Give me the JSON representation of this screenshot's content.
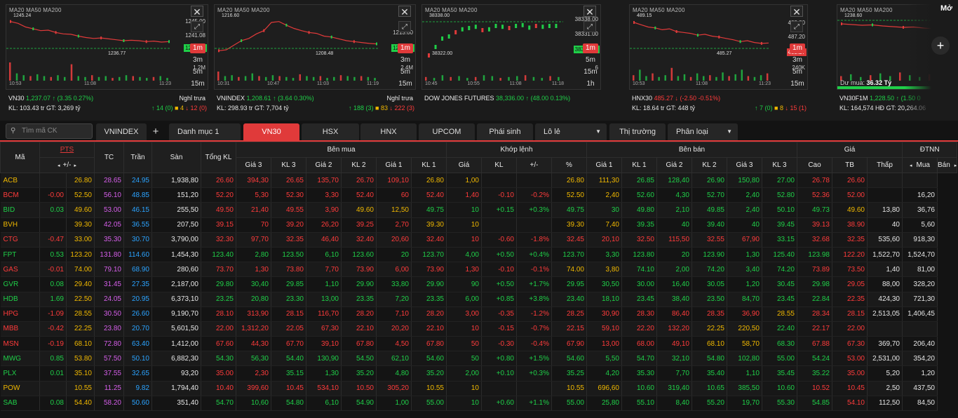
{
  "charts": [
    {
      "ma": "MA20 MA50 MA200",
      "hi": "1245.24",
      "lo": "1236.77",
      "axis": [
        "1245.00",
        "1241.08",
        "1237.37",
        "1.2M"
      ],
      "times": [
        "10:53",
        "11:08",
        "11:23"
      ],
      "name": "VN30",
      "price": "1,237.07",
      "change": "↑ (3.35 0.27%)",
      "status": "Nghỉ trưa",
      "kl": "KL: 103.43 tr",
      "gt": "GT: 3,269 tỷ",
      "up": "↑ 14 (0)",
      "ref": "■ 4",
      "down": "↓ 12 (0)",
      "tf": [
        "1m",
        "3m",
        "5m",
        "15m"
      ]
    },
    {
      "ma": "MA20 MA50 MA200",
      "hi": "1216.60",
      "lo": "1208.48",
      "axis": [
        "1213.00",
        "1208.60",
        "2.4M"
      ],
      "times": [
        "10:31",
        "10:47",
        "11:03",
        "11:19"
      ],
      "name": "VNINDEX",
      "price": "1,208.61",
      "change": "↑ (3.64 0.30%)",
      "status": "Nghỉ trưa",
      "kl": "KL: 298.93 tr",
      "gt": "GT: 7,704 tỷ",
      "up": "↑ 188 (3)",
      "ref": "■ 83",
      "down": "↓ 222 (3)",
      "tf": [
        "1m",
        "3m",
        "5m",
        "15m"
      ]
    },
    {
      "ma": "MA20 MA50 MA200",
      "hi": "38338.00",
      "lo": "38322.00",
      "axis": [
        "38338.00",
        "38331.00",
        "38322.00",
        "6"
      ],
      "times": [
        "10:45",
        "10:55",
        "11:08",
        "11:18"
      ],
      "name": "DOW JONES FUTURES",
      "price": "38,336.00",
      "change": "↑ (48.00 0.13%)",
      "status": "",
      "kl": "",
      "gt": "",
      "up": "",
      "ref": "",
      "down": "",
      "tf": [
        "1m",
        "5m",
        "15m",
        "1h"
      ]
    },
    {
      "ma": "MA20 MA50 MA200",
      "hi": "489.15",
      "lo": "485.27",
      "axis": [
        "488.80",
        "487.20",
        "485.27",
        "240K"
      ],
      "times": [
        "10:53",
        "11:08",
        "11:23"
      ],
      "name": "HNX30",
      "price": "485.27",
      "change": "↓ (-2.50 -0.51%)",
      "status": "",
      "kl": "KL: 18.64 tr",
      "gt": "GT: 448 tỷ",
      "up": "↑ 7 (0)",
      "ref": "■ 8",
      "down": "↓ 15 (1)",
      "tf": [
        "1m",
        "3m",
        "5m",
        "15m"
      ]
    },
    {
      "ma": "MA20 MA50 MA200",
      "hi": "1238.60",
      "lo": "",
      "axis": [],
      "times": [],
      "name": "VN30F1M",
      "price": "1,228.50",
      "change": "↑ (1.50 0",
      "status": "",
      "kl": "KL: 164,574 HĐ",
      "gt": "GT: 20,264.06",
      "up": "",
      "ref": "",
      "down": "",
      "tf": [],
      "du_mua_label": "Dư mua:",
      "du_mua_value": "36.32 Tỷ"
    }
  ],
  "more_label": "Mở",
  "search_placeholder": "Tìm mã CK",
  "tabs": [
    "VNINDEX",
    "+",
    "Danh mục 1",
    "VN30",
    "HSX",
    "HNX",
    "UPCOM",
    "Phái sinh",
    "Lô lẻ",
    "Thị trường",
    "Phân loại"
  ],
  "headers": {
    "ma": "Mã",
    "pts": "PTS",
    "plusminus": "+/-",
    "tc": "TC",
    "tran": "Trần",
    "san": "Sàn",
    "tongkl": "Tổng KL",
    "benmua": "Bên mua",
    "khoplenh": "Khớp lệnh",
    "benban": "Bên bán",
    "gia": "Giá",
    "dtnn": "ĐTNN",
    "buy": [
      "Giá 3",
      "KL 3",
      "Giá 2",
      "KL 2",
      "Giá 1",
      "KL 1"
    ],
    "match": [
      "Giá",
      "KL",
      "+/-",
      "%"
    ],
    "sell": [
      "Giá 1",
      "KL 1",
      "Giá 2",
      "KL 2",
      "Giá 3",
      "KL 3"
    ],
    "price": [
      "Cao",
      "TB",
      "Thấp"
    ],
    "foreign": [
      "Mua",
      "Bán"
    ]
  },
  "rows": [
    [
      "ACB",
      "",
      "26.80",
      "28.65",
      "24.95",
      "1,938,80",
      "26.60",
      "394,30",
      "26.65",
      "135,70",
      "26.70",
      "109,10",
      "26.80",
      "1,00",
      "",
      "",
      "26.80",
      "111,30",
      "26.85",
      "128,40",
      "26.90",
      "150,80",
      "27.00",
      "26.78",
      "26.60",
      "",
      ""
    ],
    [
      "BCM",
      "-0.00",
      "52.50",
      "56.10",
      "48.85",
      "151,20",
      "52.20",
      "5,30",
      "52.30",
      "3,30",
      "52.40",
      "60",
      "52.40",
      "1,40",
      "-0.10",
      "-0.2%",
      "52.50",
      "2,40",
      "52.60",
      "4,30",
      "52.70",
      "2,40",
      "52.80",
      "52.36",
      "52.00",
      "",
      "16,20"
    ],
    [
      "BID",
      "0.03",
      "49.60",
      "53.00",
      "46.15",
      "255,50",
      "49.50",
      "21,40",
      "49.55",
      "3,90",
      "49.60",
      "12,50",
      "49.75",
      "10",
      "+0.15",
      "+0.3%",
      "49.75",
      "30",
      "49.80",
      "2,10",
      "49.85",
      "2,40",
      "50.10",
      "49.73",
      "49.60",
      "13,80",
      "36,76"
    ],
    [
      "BVH",
      "",
      "39.30",
      "42.05",
      "36.55",
      "207,50",
      "39.15",
      "70",
      "39.20",
      "26,20",
      "39.25",
      "2,70",
      "39.30",
      "10",
      "",
      "",
      "39.30",
      "7,40",
      "39.35",
      "40",
      "39.40",
      "40",
      "39.45",
      "39.13",
      "38.90",
      "40",
      "5,60"
    ],
    [
      "CTG",
      "-0.47",
      "33.00",
      "35.30",
      "30.70",
      "3,790,00",
      "32.30",
      "97,70",
      "32.35",
      "46,40",
      "32.40",
      "20,60",
      "32.40",
      "10",
      "-0.60",
      "-1.8%",
      "32.45",
      "20,10",
      "32.50",
      "115,50",
      "32.55",
      "67,90",
      "33.15",
      "32.68",
      "32.35",
      "535,60",
      "918,30"
    ],
    [
      "FPT",
      "0.53",
      "123.20",
      "131.80",
      "114.60",
      "1,454,30",
      "123.40",
      "2,80",
      "123.50",
      "6,10",
      "123.60",
      "20",
      "123.70",
      "4,00",
      "+0.50",
      "+0.4%",
      "123.70",
      "3,30",
      "123.80",
      "20",
      "123.90",
      "1,30",
      "125.40",
      "123.98",
      "122.20",
      "1,522,70",
      "1,524,70"
    ],
    [
      "GAS",
      "-0.01",
      "74.00",
      "79.10",
      "68.90",
      "280,60",
      "73.70",
      "1,30",
      "73.80",
      "7,70",
      "73.90",
      "6,00",
      "73.90",
      "1,30",
      "-0.10",
      "-0.1%",
      "74.00",
      "3,80",
      "74.10",
      "2,00",
      "74.20",
      "3,40",
      "74.20",
      "73.89",
      "73.50",
      "1,40",
      "81,00"
    ],
    [
      "GVR",
      "0.08",
      "29.40",
      "31.45",
      "27.35",
      "2,187,00",
      "29.80",
      "30,40",
      "29.85",
      "1,10",
      "29.90",
      "33,80",
      "29.90",
      "90",
      "+0.50",
      "+1.7%",
      "29.95",
      "30,50",
      "30.00",
      "16,40",
      "30.05",
      "1,20",
      "30.45",
      "29.98",
      "29.05",
      "88,00",
      "328,20"
    ],
    [
      "HDB",
      "1.69",
      "22.50",
      "24.05",
      "20.95",
      "6,373,10",
      "23.25",
      "20,80",
      "23.30",
      "13,00",
      "23.35",
      "7,20",
      "23.35",
      "6,00",
      "+0.85",
      "+3.8%",
      "23.40",
      "18,10",
      "23.45",
      "38,40",
      "23.50",
      "84,70",
      "23.45",
      "22.84",
      "22.35",
      "424,30",
      "721,30"
    ],
    [
      "HPG",
      "-1.09",
      "28.55",
      "30.50",
      "26.60",
      "9,190,70",
      "28.10",
      "313,90",
      "28.15",
      "116,70",
      "28.20",
      "7,10",
      "28.20",
      "3,00",
      "-0.35",
      "-1.2%",
      "28.25",
      "30,90",
      "28.30",
      "86,40",
      "28.35",
      "36,90",
      "28.55",
      "28.34",
      "28.15",
      "2,513,05",
      "1,406,45"
    ],
    [
      "MBB",
      "-0.42",
      "22.25",
      "23.80",
      "20.70",
      "5,601,50",
      "22.00",
      "1,312,20",
      "22.05",
      "67,30",
      "22.10",
      "20,20",
      "22.10",
      "10",
      "-0.15",
      "-0.7%",
      "22.15",
      "59,10",
      "22.20",
      "132,20",
      "22.25",
      "220,50",
      "22.40",
      "22.17",
      "22.00",
      "",
      ""
    ],
    [
      "MSN",
      "-0.19",
      "68.10",
      "72.80",
      "63.40",
      "1,412,00",
      "67.60",
      "44,30",
      "67.70",
      "39,10",
      "67.80",
      "4,50",
      "67.80",
      "50",
      "-0.30",
      "-0.4%",
      "67.90",
      "13,00",
      "68.00",
      "49,10",
      "68.10",
      "58,70",
      "68.30",
      "67.88",
      "67.30",
      "369,70",
      "206,40"
    ],
    [
      "MWG",
      "0.85",
      "53.80",
      "57.50",
      "50.10",
      "6,882,30",
      "54.30",
      "56,30",
      "54.40",
      "130,90",
      "54.50",
      "62,10",
      "54.60",
      "50",
      "+0.80",
      "+1.5%",
      "54.60",
      "5,50",
      "54.70",
      "32,10",
      "54.80",
      "102,80",
      "55.00",
      "54.24",
      "53.00",
      "2,531,00",
      "354,20"
    ],
    [
      "PLX",
      "0.01",
      "35.10",
      "37.55",
      "32.65",
      "93,20",
      "35.00",
      "2,30",
      "35.15",
      "1,30",
      "35.20",
      "4,80",
      "35.20",
      "2,00",
      "+0.10",
      "+0.3%",
      "35.25",
      "4,20",
      "35.30",
      "7,70",
      "35.40",
      "1,10",
      "35.45",
      "35.22",
      "35.00",
      "5,20",
      "1,20"
    ],
    [
      "POW",
      "",
      "10.55",
      "11.25",
      "9.82",
      "1,794,40",
      "10.40",
      "399,60",
      "10.45",
      "534,10",
      "10.50",
      "305,20",
      "10.55",
      "10",
      "",
      "",
      "10.55",
      "696,60",
      "10.60",
      "319,40",
      "10.65",
      "385,50",
      "10.60",
      "10.52",
      "10.45",
      "2,50",
      "437,50"
    ],
    [
      "SAB",
      "0.08",
      "54.40",
      "58.20",
      "50.60",
      "351,40",
      "54.70",
      "10,60",
      "54.80",
      "6,10",
      "54.90",
      "1,00",
      "55.00",
      "10",
      "+0.60",
      "+1.1%",
      "55.00",
      "25,80",
      "55.10",
      "8,40",
      "55.20",
      "19,70",
      "55.30",
      "54.85",
      "54.10",
      "112,50",
      "84,50"
    ]
  ]
}
